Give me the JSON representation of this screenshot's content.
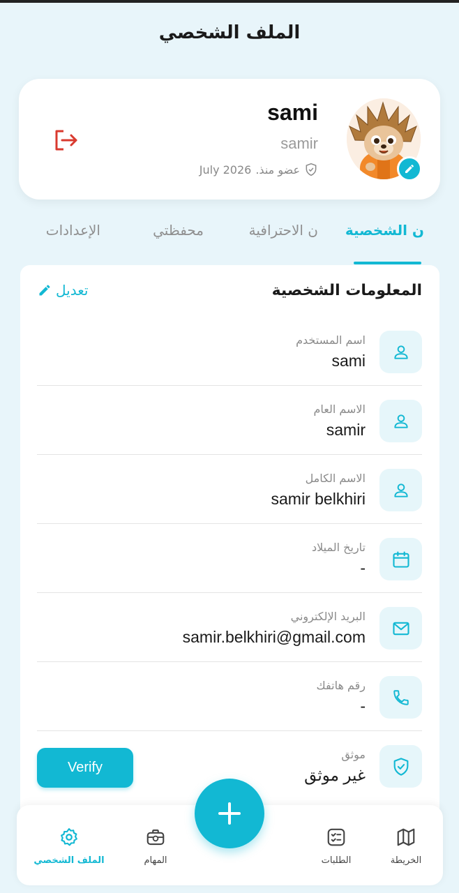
{
  "header": {
    "title": "الملف الشخصي"
  },
  "profile": {
    "name": "sami",
    "username": "samir",
    "member_since_prefix": "عضو منذ.",
    "member_since_date": "July 2026"
  },
  "tabs": [
    {
      "label": "ن الشخصية",
      "active": true
    },
    {
      "label": "ن الاحترافية",
      "active": false
    },
    {
      "label": "محفظتي",
      "active": false
    },
    {
      "label": "الإعدادات",
      "active": false
    }
  ],
  "info": {
    "section_title": "المعلومات الشخصية",
    "edit_label": "تعديل",
    "rows": [
      {
        "label": "اسم المستخدم",
        "value": "sami",
        "icon": "user-icon"
      },
      {
        "label": "الاسم العام",
        "value": "samir",
        "icon": "user-icon"
      },
      {
        "label": "الاسم الكامل",
        "value": "samir belkhiri",
        "icon": "user-icon"
      },
      {
        "label": "تاريخ الميلاد",
        "value": "-",
        "icon": "calendar-icon"
      },
      {
        "label": "البريد الإلكتروني",
        "value": "samir.belkhiri@gmail.com",
        "icon": "mail-icon"
      },
      {
        "label": "رقم هاتفك",
        "value": "-",
        "icon": "phone-icon"
      },
      {
        "label": "موثق",
        "value": "غير موثق",
        "icon": "shield-check-icon"
      }
    ],
    "verify_label": "Verify"
  },
  "nav": {
    "items": [
      {
        "label": "الخريطة",
        "icon": "map-icon",
        "active": false
      },
      {
        "label": "الطلبات",
        "icon": "checklist-icon",
        "active": false
      },
      {
        "label": "المهام",
        "icon": "briefcase-icon",
        "active": false
      },
      {
        "label": "الملف الشخصي",
        "icon": "gear-icon",
        "active": true
      }
    ],
    "fab_icon": "plus-icon"
  },
  "colors": {
    "accent": "#12b8d3",
    "background": "#e8f5fa",
    "logout": "#d93a2f"
  }
}
